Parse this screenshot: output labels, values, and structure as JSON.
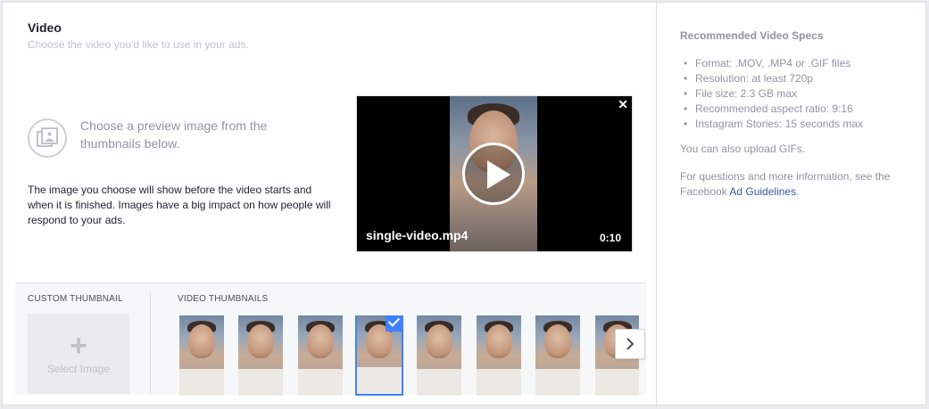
{
  "header": {
    "title": "Video",
    "subtitle": "Choose the video you'd like to use in your ads."
  },
  "preview": {
    "heading": "Choose a preview image from the thumbnails below.",
    "description": "The image you choose will show before the video starts and when it is finished. Images have a big impact on how people will respond to your ads.",
    "icon": "image-gallery-icon"
  },
  "video": {
    "filename": "single-video.mp4",
    "duration": "0:10",
    "close_label": "✕",
    "icons": [
      "play-icon",
      "close-icon"
    ]
  },
  "thumbnails": {
    "custom_label": "CUSTOM THUMBNAIL",
    "select_plus": "+",
    "select_label": "Select Image",
    "video_label": "VIDEO THUMBNAILS",
    "count": 8,
    "selected_index": 3,
    "accent_color": "#4080ff",
    "next_icon": "chevron-right-icon"
  },
  "specs": {
    "title": "Recommended Video Specs",
    "items": [
      "Format: .MOV, .MP4 or .GIF files",
      "Resolution: at least 720p",
      "File size: 2.3 GB max",
      "Recommended aspect ratio: 9:16",
      "Instagram Stories: 15 seconds max"
    ],
    "gif_note": "You can also upload GIFs.",
    "info_prefix": "For questions and more information, see the Facebook ",
    "info_link": "Ad Guidelines",
    "info_suffix": ".",
    "link_color": "#365899"
  }
}
